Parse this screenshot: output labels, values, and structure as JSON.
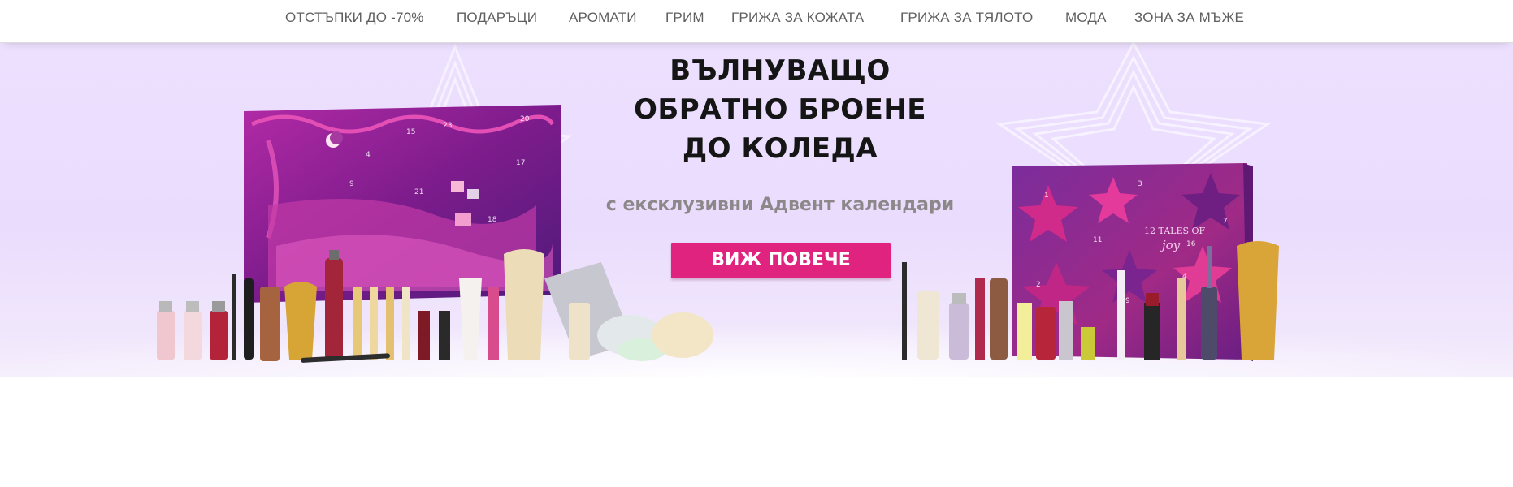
{
  "nav": {
    "items": [
      {
        "label": "ОТСТЪПКИ ДО -70%"
      },
      {
        "label": "ПОДАРЪЦИ"
      },
      {
        "label": "АРОМАТИ"
      },
      {
        "label": "ГРИМ"
      },
      {
        "label": "ГРИЖА ЗА КОЖАТА"
      },
      {
        "label": "ГРИЖА ЗА ТЯЛОТО"
      },
      {
        "label": "МОДА"
      },
      {
        "label": "ЗОНА ЗА МЪЖЕ"
      }
    ]
  },
  "banner": {
    "headline_lines": [
      "ВЪЛНУВАЩО",
      "ОБРАТНО БРОЕНЕ",
      "ДО КОЛЕДА"
    ],
    "subline": "с ексклузивни Адвент календари",
    "cta_label": "ВИЖ ПОВЕЧЕ",
    "calendar_right_label": "12 TALES OF",
    "calendar_right_script": "joy",
    "colors": {
      "background": "#ede0ff",
      "cta": "#e0237f",
      "calendar_left": "#7d1c8c",
      "calendar_right": "#9a2a86"
    }
  }
}
